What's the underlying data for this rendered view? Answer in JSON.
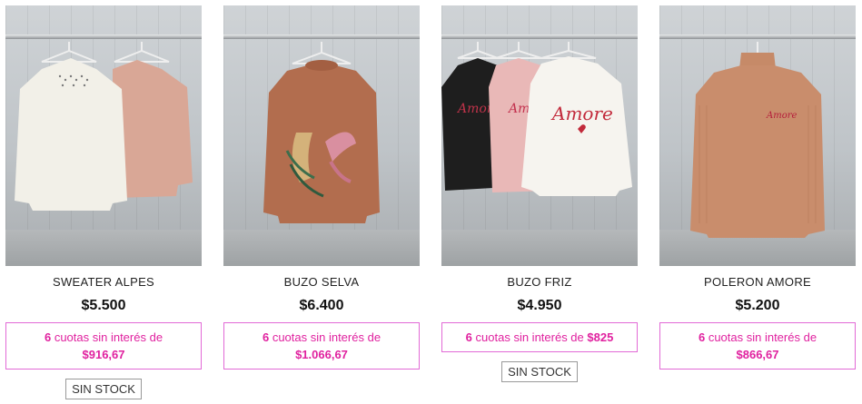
{
  "products": [
    {
      "name": "SWEATER ALPES",
      "price": "$5.500",
      "installments_count": "6",
      "installments_text": "cuotas sin interés de",
      "installments_amount": "$916,67",
      "stock_label": "SIN STOCK"
    },
    {
      "name": "BUZO SELVA",
      "price": "$6.400",
      "installments_count": "6",
      "installments_text": "cuotas sin interés de",
      "installments_amount": "$1.066,67",
      "stock_label": ""
    },
    {
      "name": "BUZO FRIZ",
      "price": "$4.950",
      "installments_count": "6",
      "installments_text": "cuotas sin interés de",
      "installments_amount": "$825",
      "stock_label": "SIN STOCK"
    },
    {
      "name": "POLERON AMORE",
      "price": "$5.200",
      "installments_count": "6",
      "installments_text": "cuotas sin interés de",
      "installments_amount": "$866,67",
      "stock_label": ""
    }
  ],
  "garment_prints": {
    "friz_black": "Amore",
    "friz_pink": "Amore",
    "friz_white": "Amore",
    "poleron": "Amore"
  },
  "colors": {
    "installments_text": "#e0219f",
    "installments_border": "#e26ad6"
  }
}
